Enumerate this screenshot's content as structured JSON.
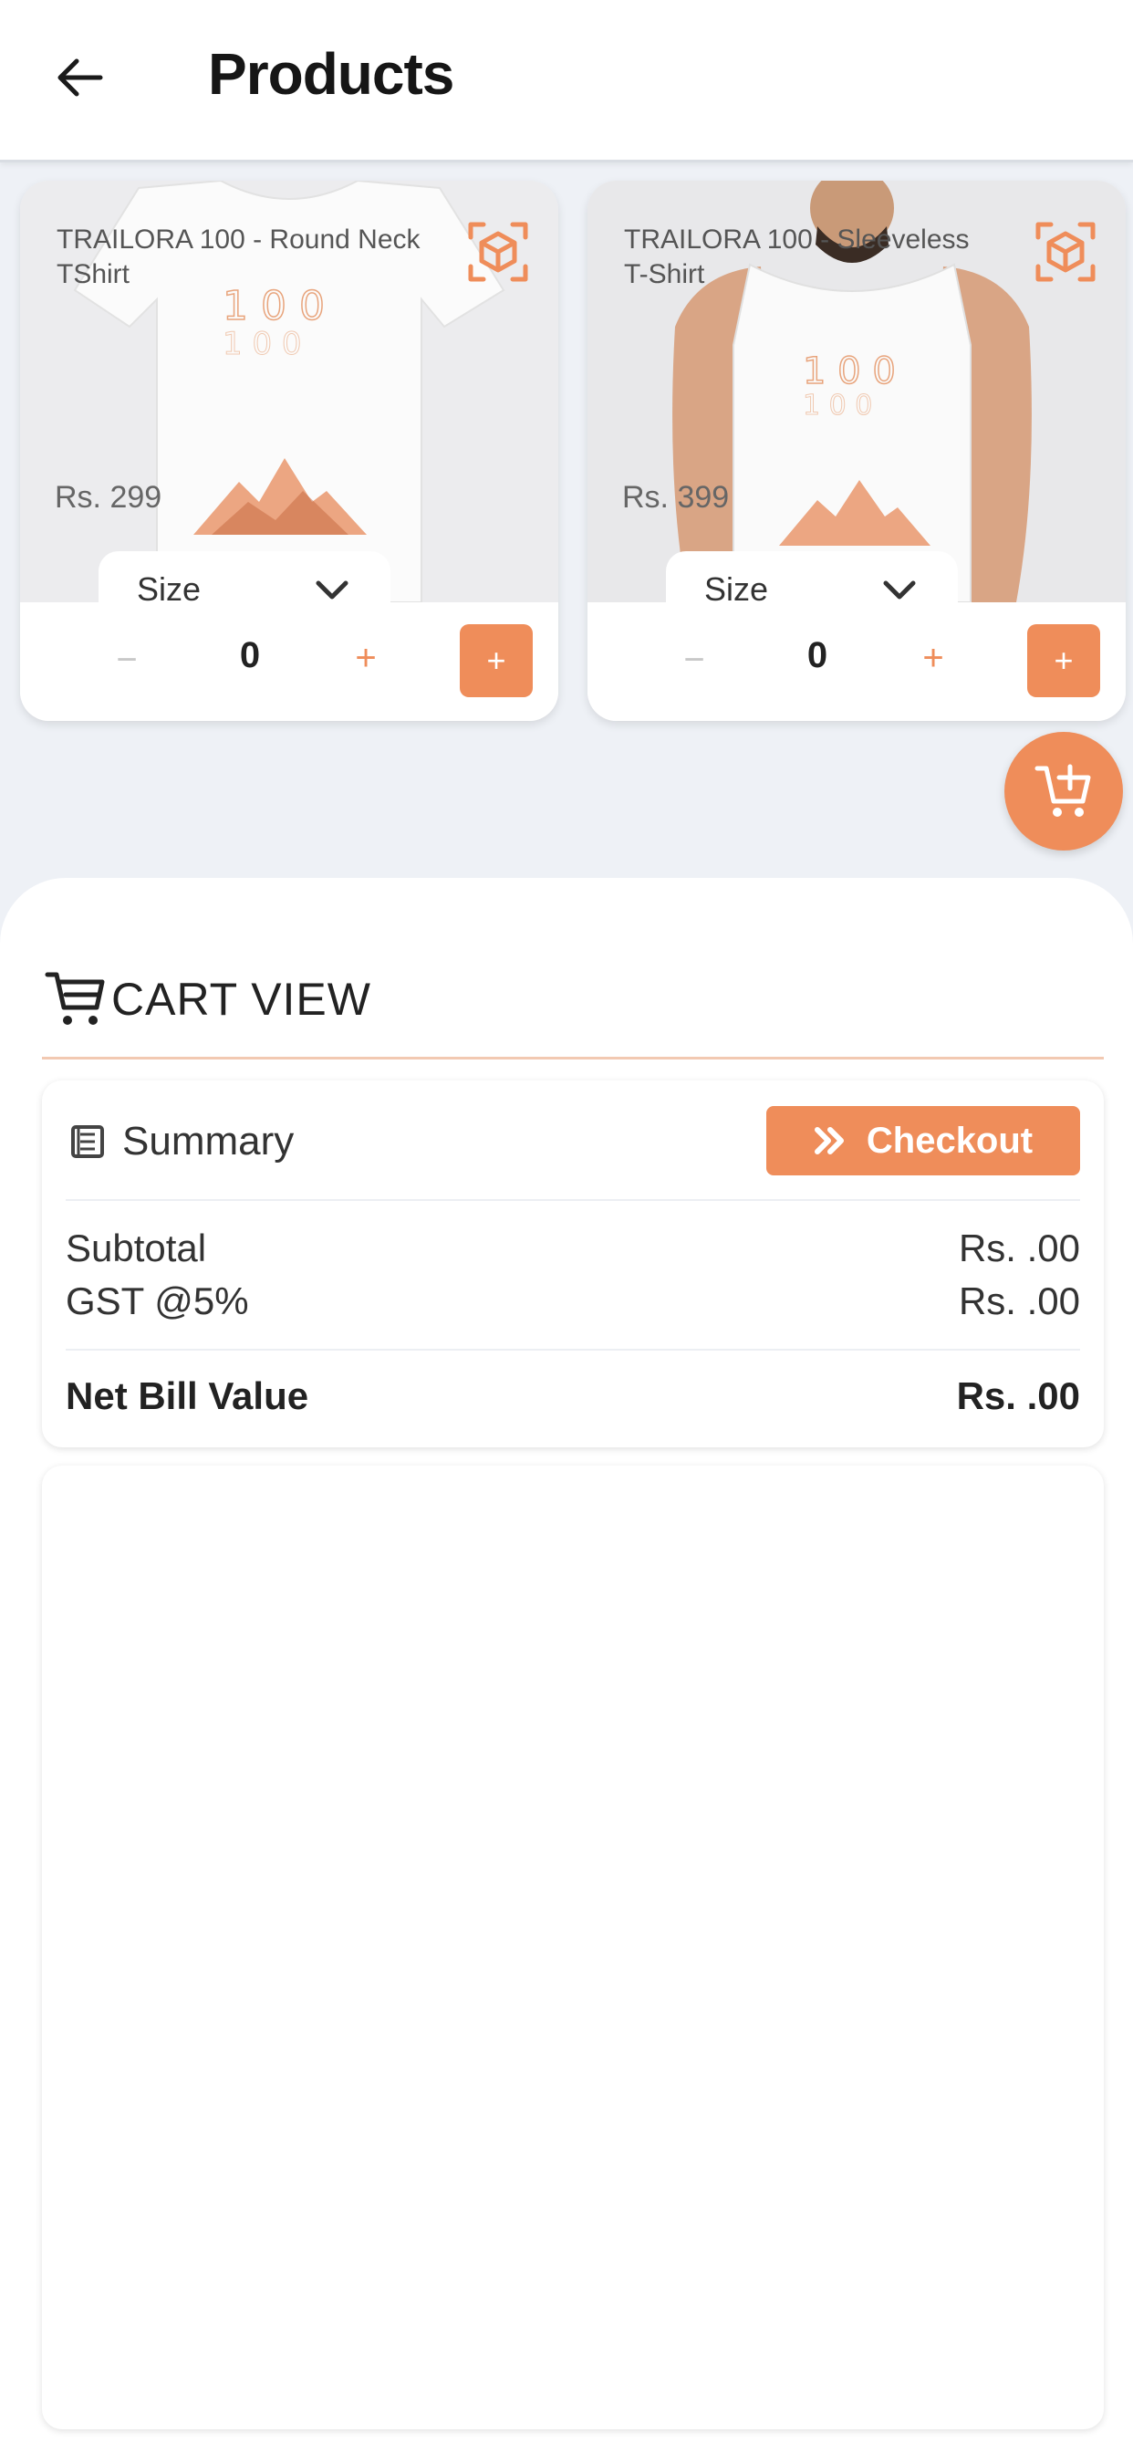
{
  "appbar": {
    "title": "Products",
    "back_icon": "arrow-left-icon"
  },
  "products": [
    {
      "name": "TRAILORA 100 - Round Neck TShirt",
      "price": "Rs. 299",
      "size_label": "Size",
      "qty_minus": "−",
      "quantity": "0",
      "qty_plus": "+",
      "add_label": "+",
      "ar_icon": "cube-scan-icon"
    },
    {
      "name": "TRAILORA 100 - Sleeveless T-Shirt",
      "price": "Rs. 399",
      "size_label": "Size",
      "qty_minus": "−",
      "quantity": "0",
      "qty_plus": "+",
      "add_label": "+",
      "ar_icon": "cube-scan-icon"
    }
  ],
  "fab": {
    "icon": "cart-add-icon"
  },
  "cart": {
    "title": "CART VIEW",
    "icon": "cart-icon"
  },
  "summary": {
    "label": "Summary",
    "icon": "receipt-icon",
    "checkout_label": "Checkout",
    "checkout_icon": "double-chevron-right-icon",
    "subtotal_label": "Subtotal",
    "subtotal_value": "Rs. .00",
    "gst_label": "GST @5%",
    "gst_value": "Rs. .00",
    "net_label": "Net Bill Value",
    "net_value": "Rs. .00"
  },
  "colors": {
    "accent": "#ef8d5a",
    "background": "#eef1f6",
    "surface": "#ffffff"
  }
}
